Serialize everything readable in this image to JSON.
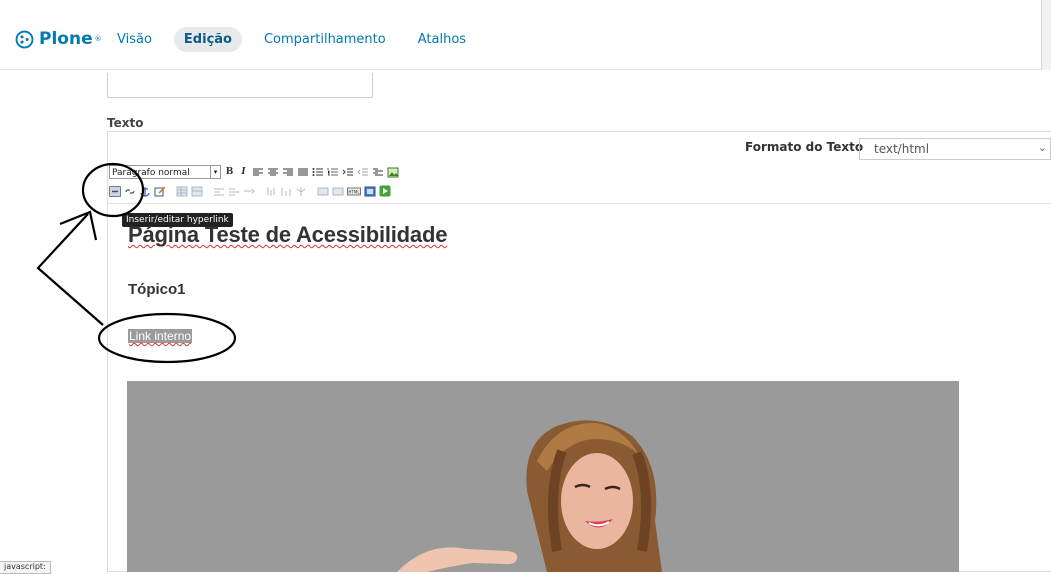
{
  "brand": {
    "name": "Plone",
    "mark": "®",
    "color": "#007bb1"
  },
  "nav": {
    "items": [
      {
        "label": "Visão",
        "active": false
      },
      {
        "label": "Edição",
        "active": true
      },
      {
        "label": "Compartilhamento",
        "active": false
      },
      {
        "label": "Atalhos",
        "active": false
      }
    ]
  },
  "form": {
    "field_label": "Texto",
    "format_label": "Formato do Texto",
    "format_value": "text/html"
  },
  "toolbar": {
    "paragraph_value": "Parágrafo normal",
    "tooltip": "Inserir/editar hyperlink",
    "row1_icons": [
      "bold-icon",
      "italic-icon",
      "align-left-icon",
      "align-center-icon",
      "align-right-icon",
      "align-justify-icon",
      "bullet-list-icon",
      "numbered-list-icon",
      "indent-icon",
      "outdent-icon",
      "definition-list-icon",
      "image-icon"
    ],
    "row2_icons": [
      "link-icon",
      "unlink-icon",
      "anchor-icon",
      "edit-icon",
      "table-icon",
      "table-props-icon",
      "row-props-icon",
      "cell-props-icon",
      "row-insert-icon",
      "col-insert-icon",
      "split-icon",
      "template-icon",
      "visual-aid-icon",
      "html-source-icon",
      "preview-icon",
      "fullscreen-icon"
    ]
  },
  "content": {
    "heading": "Página Teste de Acessibilidade",
    "subheading": "Tópico1",
    "link_text": "Link interno"
  },
  "status_bar": {
    "text": "javascript:"
  }
}
